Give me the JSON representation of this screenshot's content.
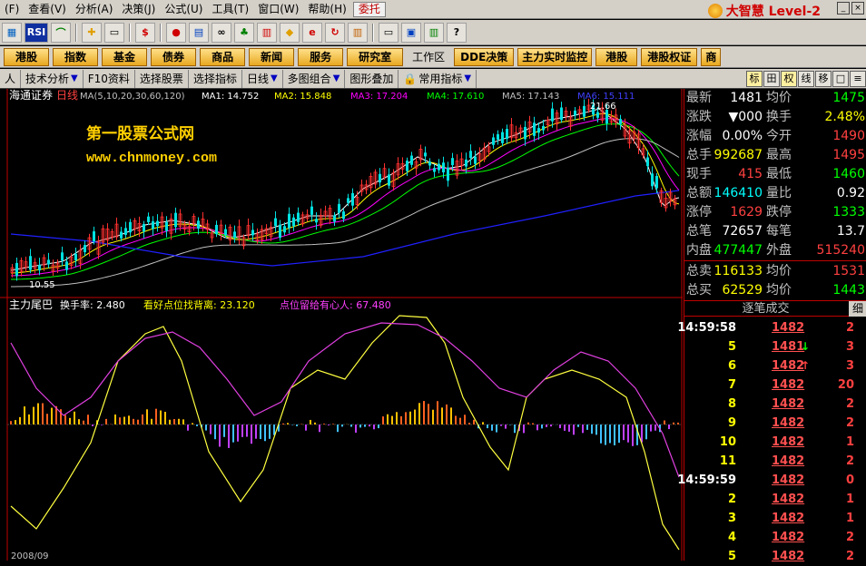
{
  "menu": {
    "items": [
      "(F)",
      "查看(V)",
      "分析(A)",
      "决策(J)",
      "公式(U)",
      "工具(T)",
      "窗口(W)",
      "帮助(H)"
    ],
    "trust": "委托",
    "brand": "大智慧 Level-2"
  },
  "navbar": {
    "buttons": [
      "港股",
      "指数",
      "基金",
      "债券",
      "商品",
      "新闻",
      "服务",
      "研究室"
    ],
    "workzone": "工作区",
    "right": [
      "DDE决策",
      "主力实时监控",
      "港股",
      "港股权证",
      "商"
    ]
  },
  "tabbar": {
    "tabs": [
      "人",
      "技术分析",
      "F10资料",
      "选择股票",
      "选择指标",
      "日线",
      "多图组合",
      "图形叠加",
      "常用指标"
    ],
    "right_tools": [
      "标",
      "田",
      "权",
      "线",
      "移",
      "□",
      "≡"
    ]
  },
  "chart": {
    "stock": "海通证券",
    "period": "日线",
    "ma_def": "MA(5,10,20,30,60,120)",
    "ma": [
      {
        "label": "MA1: 14.752",
        "color": "#ffffff"
      },
      {
        "label": "MA2: 15.848",
        "color": "#ffff00"
      },
      {
        "label": "MA3: 17.204",
        "color": "#ff00ff"
      },
      {
        "label": "MA4: 17.610",
        "color": "#00ff00"
      },
      {
        "label": "MA5: 17.143",
        "color": "#c0c0c0"
      },
      {
        "label": "MA6: 15.111",
        "color": "#0000ff"
      }
    ],
    "watermark1": "第一股票公式网",
    "watermark2": "www.chnmoney.com",
    "high_label": "21.66",
    "low_label": "10.55",
    "indicator_name": "主力尾巴",
    "ind1": "换手率: 2.480",
    "ind2": "看好点位找背离: 23.120",
    "ind3": "点位留给有心人: 67.480",
    "date_label": "2008/09"
  },
  "quote": {
    "rows": [
      {
        "l1": "最新",
        "v1": "1481",
        "c1": "wht",
        "l2": "均价",
        "v2": "1475",
        "c2": "grn"
      },
      {
        "l1": "涨跌",
        "v1": "▼000",
        "c1": "wht",
        "l2": "换手",
        "v2": "2.48%",
        "c2": "yel"
      },
      {
        "l1": "涨幅",
        "v1": "0.00%",
        "c1": "wht",
        "l2": "今开",
        "v2": "1490",
        "c2": "red"
      },
      {
        "l1": "总手",
        "v1": "992687",
        "c1": "yel",
        "l2": "最高",
        "v2": "1495",
        "c2": "red"
      },
      {
        "l1": "现手",
        "v1": "415",
        "c1": "red",
        "l2": "最低",
        "v2": "1460",
        "c2": "grn"
      },
      {
        "l1": "总额",
        "v1": "146410",
        "c1": "cyn",
        "l2": "量比",
        "v2": "0.92",
        "c2": "wht"
      },
      {
        "l1": "涨停",
        "v1": "1629",
        "c1": "red",
        "l2": "跌停",
        "v2": "1333",
        "c2": "grn"
      },
      {
        "l1": "总笔",
        "v1": "72657",
        "c1": "wht",
        "l2": "每笔",
        "v2": "13.7",
        "c2": "wht"
      },
      {
        "l1": "内盘",
        "v1": "477447",
        "c1": "grn",
        "l2": "外盘",
        "v2": "515240",
        "c2": "red"
      },
      {
        "l1": "总卖",
        "v1": "116133",
        "c1": "yel",
        "l2": "均价",
        "v2": "1531",
        "c2": "red"
      },
      {
        "l1": "总买",
        "v1": "62529",
        "c1": "yel",
        "l2": "均价",
        "v2": "1443",
        "c2": "grn"
      }
    ],
    "ticks_title": "逐笔成交",
    "ticks_btn": "细",
    "ticks": [
      {
        "t": "14:59:58",
        "tc": "wht",
        "p": "1482",
        "a": "",
        "v": "2"
      },
      {
        "t": "5",
        "tc": "yel",
        "p": "1481",
        "a": "↓",
        "v": "3",
        "pc": "wht"
      },
      {
        "t": "6",
        "tc": "yel",
        "p": "1482",
        "a": "↑",
        "v": "3"
      },
      {
        "t": "7",
        "tc": "yel",
        "p": "1482",
        "a": "",
        "v": "20"
      },
      {
        "t": "8",
        "tc": "yel",
        "p": "1482",
        "a": "",
        "v": "2"
      },
      {
        "t": "9",
        "tc": "yel",
        "p": "1482",
        "a": "",
        "v": "2"
      },
      {
        "t": "10",
        "tc": "yel",
        "p": "1482",
        "a": "",
        "v": "1"
      },
      {
        "t": "11",
        "tc": "yel",
        "p": "1482",
        "a": "",
        "v": "2"
      },
      {
        "t": "14:59:59",
        "tc": "wht",
        "p": "1482",
        "a": "",
        "v": "0"
      },
      {
        "t": "2",
        "tc": "yel",
        "p": "1482",
        "a": "",
        "v": "1"
      },
      {
        "t": "3",
        "tc": "yel",
        "p": "1482",
        "a": "",
        "v": "1"
      },
      {
        "t": "4",
        "tc": "yel",
        "p": "1482",
        "a": "",
        "v": "2"
      },
      {
        "t": "5",
        "tc": "yel",
        "p": "1482",
        "a": "",
        "v": "2"
      }
    ]
  }
}
